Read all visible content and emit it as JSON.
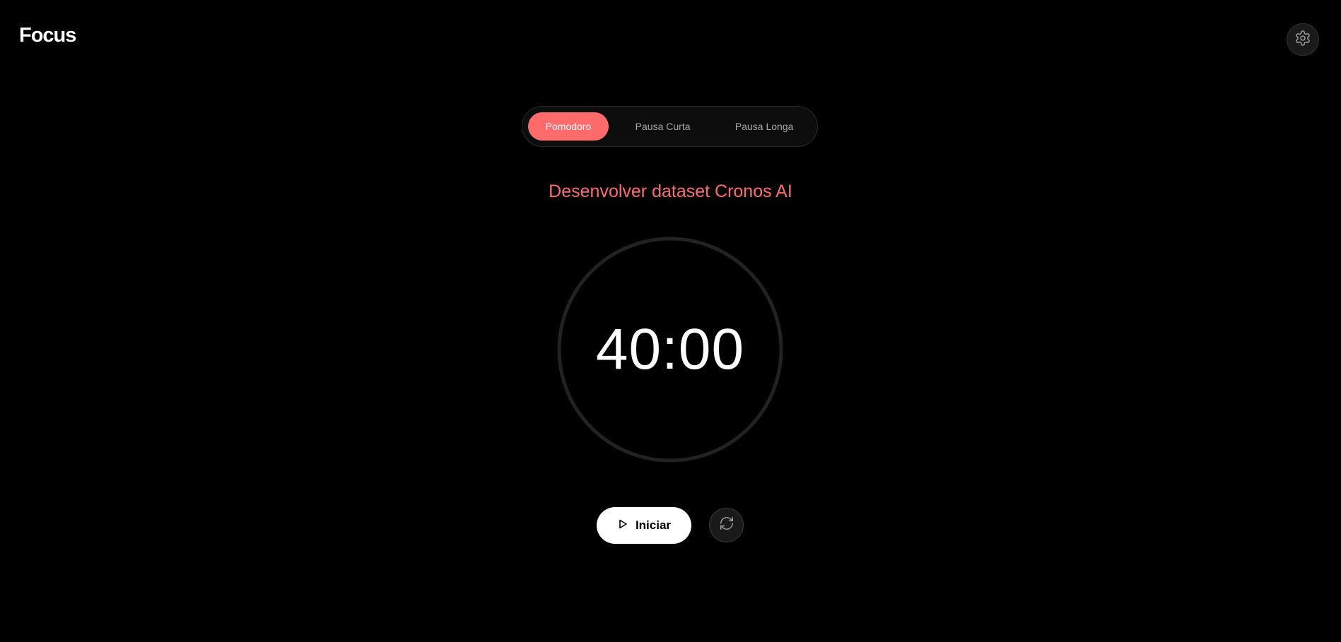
{
  "header": {
    "logo": "Focus",
    "settings_icon": "gear-icon"
  },
  "modes": {
    "tabs": [
      {
        "label": "Pomodoro",
        "active": true
      },
      {
        "label": "Pausa Curta",
        "active": false
      },
      {
        "label": "Pausa Longa",
        "active": false
      }
    ]
  },
  "task": {
    "title": "Desenvolver dataset Cronos AI"
  },
  "timer": {
    "display": "40:00"
  },
  "controls": {
    "start_label": "Iniciar",
    "start_icon": "play-icon",
    "reset_icon": "refresh-icon"
  },
  "colors": {
    "background": "#000000",
    "accent": "#ff6b6b",
    "ring": "#222222",
    "button_bg": "#ffffff"
  }
}
